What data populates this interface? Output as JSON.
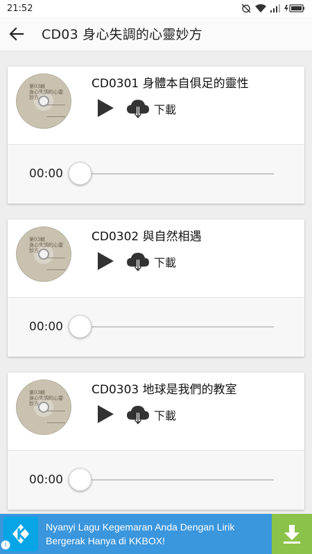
{
  "status_bar": {
    "time": "21:52",
    "icons": [
      "alarm-off-icon",
      "wifi-icon",
      "signal-icon",
      "battery-charging-icon"
    ]
  },
  "app_bar": {
    "back_icon": "arrow-left-icon",
    "title": "CD03 身心失調的心靈妙方"
  },
  "cd_cover": {
    "line1": "第03輯",
    "line2": "身心失調的心靈妙方"
  },
  "tracks": [
    {
      "title": "CD0301 身體本自俱足的靈性",
      "download_label": "下載",
      "time": "00:00",
      "progress": 0
    },
    {
      "title": "CD0302 與自然相遇",
      "download_label": "下載",
      "time": "00:00",
      "progress": 0
    },
    {
      "title": "CD0303 地球是我們的教室",
      "download_label": "下載",
      "time": "00:00",
      "progress": 0
    }
  ],
  "ad": {
    "line1": "Nyanyi Lagu Kegemaran Anda Dengan Lirik",
    "line2": "Bergerak Hanya di KKBOX!",
    "logo_icon": "kkbox-logo-icon",
    "download_icon": "download-icon",
    "info_icon": "info-icon",
    "colors": {
      "banner": "#3a96dd",
      "download_button": "#8bc34a"
    }
  }
}
